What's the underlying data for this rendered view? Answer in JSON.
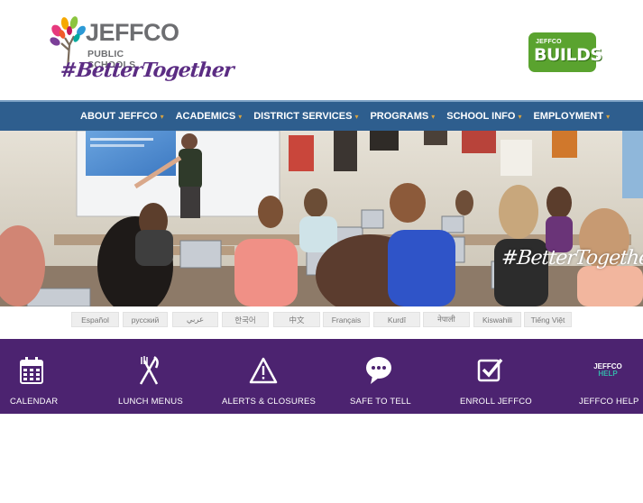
{
  "header": {
    "logo": {
      "brand": "JEFFCO",
      "subtitle": "PUBLIC SCHOOLS",
      "tagline": "#BetterTogether"
    },
    "badge": {
      "top": "JEFFCO",
      "main": "BUILDS",
      "color": "#5aa32f"
    }
  },
  "nav": {
    "items": [
      {
        "label": "ABOUT JEFFCO"
      },
      {
        "label": "ACADEMICS"
      },
      {
        "label": "DISTRICT SERVICES"
      },
      {
        "label": "PROGRAMS"
      },
      {
        "label": "SCHOOL INFO"
      },
      {
        "label": "EMPLOYMENT"
      }
    ],
    "caret": "▾",
    "bg_color": "#2e5e8e"
  },
  "hero": {
    "overlay_text": "#BetterTogether"
  },
  "languages": [
    "Español",
    "русский",
    "عربي",
    "한국어",
    "中文",
    "Français",
    "Kurdî",
    "नेपाली",
    "Kiswahili",
    "Tiếng Việt"
  ],
  "quicklinks": {
    "bg_color": "#4c2370",
    "items": [
      {
        "label": "CALENDAR",
        "icon": "calendar-icon"
      },
      {
        "label": "LUNCH MENUS",
        "icon": "fork-knife-icon"
      },
      {
        "label": "ALERTS & CLOSURES",
        "icon": "alert-triangle-icon"
      },
      {
        "label": "SAFE TO TELL",
        "icon": "speech-bubble-icon"
      },
      {
        "label": "ENROLL JEFFCO",
        "icon": "checkbox-icon"
      },
      {
        "label": "JEFFCO HELP",
        "icon": "jeffco-help-logo",
        "logo_top": "JEFFCO",
        "logo_bottom": "HELP"
      }
    ]
  }
}
